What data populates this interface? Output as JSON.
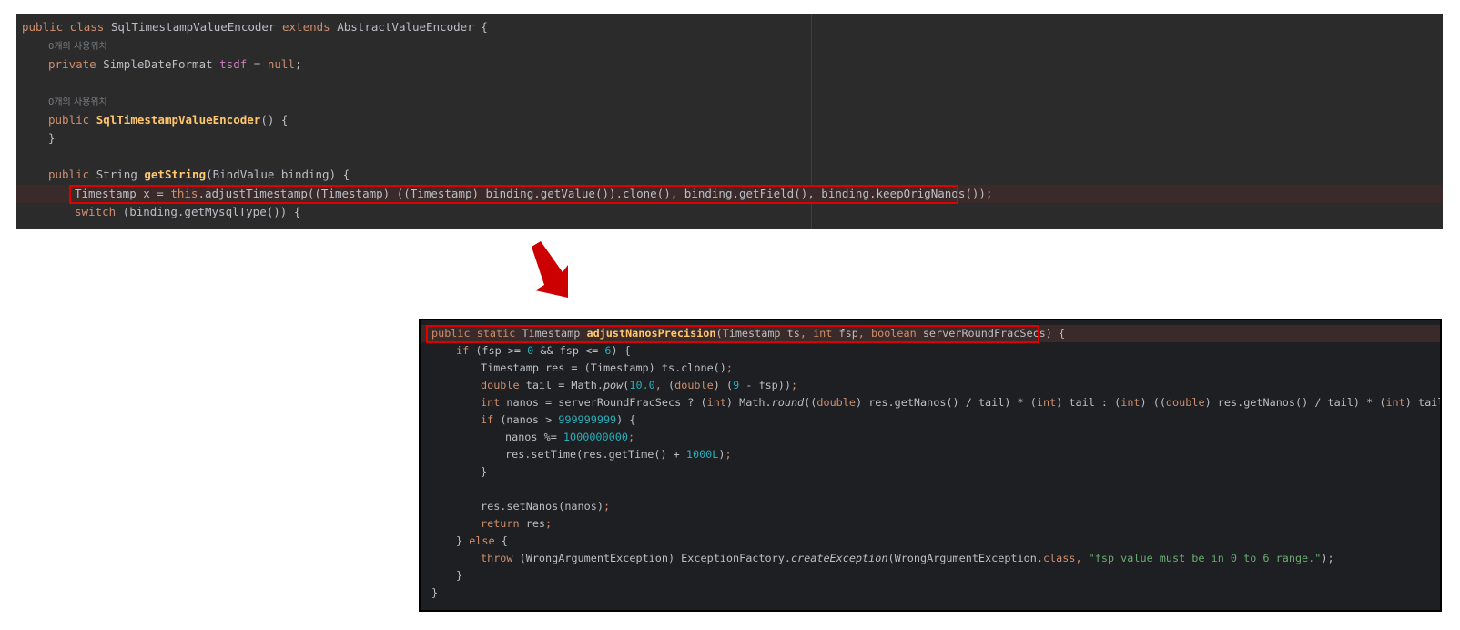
{
  "top": {
    "lines": [
      {
        "parts": [
          [
            "kw",
            "public class "
          ],
          [
            "cls",
            "SqlTimestampValueEncoder "
          ],
          [
            "kw",
            "extends "
          ],
          [
            "cls",
            "AbstractValueEncoder {"
          ]
        ]
      },
      {
        "hint": "0개의 사용위치"
      },
      {
        "parts": [
          [
            "kw",
            "private "
          ],
          [
            "cls",
            "SimpleDateFormat "
          ],
          [
            "fld",
            "tsdf"
          ],
          [
            "cls",
            " = "
          ],
          [
            "kw",
            "null"
          ],
          [
            "cls",
            ";"
          ]
        ]
      },
      {
        "parts": []
      },
      {
        "hint": "0개의 사용위치"
      },
      {
        "parts": [
          [
            "kw",
            "public "
          ],
          [
            "fn",
            "SqlTimestampValueEncoder"
          ],
          [
            "cls",
            "() {"
          ]
        ]
      },
      {
        "parts": [
          [
            "cls",
            "}"
          ]
        ]
      },
      {
        "parts": []
      },
      {
        "parts": [
          [
            "kw",
            "public "
          ],
          [
            "cls",
            "String "
          ],
          [
            "fn",
            "getString"
          ],
          [
            "cls",
            "(BindValue binding) {"
          ]
        ]
      },
      {
        "parts": [
          [
            "cls",
            "Timestamp x = "
          ],
          [
            "kw",
            "this"
          ],
          [
            "cls",
            ".adjustTimestamp((Timestamp) ((Timestamp) binding.getValue()).clone(), binding.getField(), binding.keepOrigNanos());"
          ]
        ]
      },
      {
        "parts": [
          [
            "kw",
            "switch "
          ],
          [
            "cls",
            "(binding.getMysqlType()) {"
          ]
        ]
      }
    ]
  },
  "bottom": {
    "lines": [
      {
        "parts": [
          [
            "kw",
            "public static "
          ],
          [
            "cls",
            "Timestamp "
          ],
          [
            "fn",
            "adjustNanosPrecision"
          ],
          [
            "cls",
            "(Timestamp ts"
          ],
          [
            "kw",
            ", int "
          ],
          [
            "cls",
            "fsp"
          ],
          [
            "kw",
            ", boolean "
          ],
          [
            "cls",
            "serverRoundFracSecs) {"
          ]
        ]
      },
      {
        "parts": [
          [
            "kw",
            "if "
          ],
          [
            "cls",
            "(fsp >= "
          ],
          [
            "numb",
            "0"
          ],
          [
            "cls",
            " && fsp <= "
          ],
          [
            "numb",
            "6"
          ],
          [
            "cls",
            ") {"
          ]
        ]
      },
      {
        "parts": [
          [
            "cls",
            "Timestamp res = (Timestamp) ts.clone()"
          ],
          [
            "kw",
            ";"
          ]
        ]
      },
      {
        "parts": [
          [
            "kw",
            "double "
          ],
          [
            "cls",
            "tail = Math."
          ],
          [
            "it",
            "pow"
          ],
          [
            "cls",
            "("
          ],
          [
            "numb",
            "10.0"
          ],
          [
            "kw",
            ", "
          ],
          [
            "cls",
            "("
          ],
          [
            "kw",
            "double"
          ],
          [
            "cls",
            ") ("
          ],
          [
            "numb",
            "9"
          ],
          [
            "cls",
            " - fsp))"
          ],
          [
            "kw",
            ";"
          ]
        ]
      },
      {
        "parts": [
          [
            "kw",
            "int "
          ],
          [
            "cls",
            "nanos = serverRoundFracSecs ? ("
          ],
          [
            "kw",
            "int"
          ],
          [
            "cls",
            ") Math."
          ],
          [
            "it",
            "round"
          ],
          [
            "cls",
            "(("
          ],
          [
            "kw",
            "double"
          ],
          [
            "cls",
            ") res.getNanos() / tail) * ("
          ],
          [
            "kw",
            "int"
          ],
          [
            "cls",
            ") tail : ("
          ],
          [
            "kw",
            "int"
          ],
          [
            "cls",
            ") (("
          ],
          [
            "kw",
            "double"
          ],
          [
            "cls",
            ") res.getNanos() / tail) * ("
          ],
          [
            "kw",
            "int"
          ],
          [
            "cls",
            ") tail"
          ],
          [
            "kw",
            ";"
          ]
        ]
      },
      {
        "parts": [
          [
            "kw",
            "if "
          ],
          [
            "cls",
            "(nanos > "
          ],
          [
            "numb",
            "999999999"
          ],
          [
            "cls",
            ") {"
          ]
        ]
      },
      {
        "parts": [
          [
            "cls",
            "nanos %= "
          ],
          [
            "numb",
            "1000000000"
          ],
          [
            "kw",
            ";"
          ]
        ]
      },
      {
        "parts": [
          [
            "cls",
            "res.setTime(res.getTime() + "
          ],
          [
            "numb",
            "1000L"
          ],
          [
            "cls",
            ")"
          ],
          [
            "kw",
            ";"
          ]
        ]
      },
      {
        "parts": [
          [
            "cls",
            "}"
          ]
        ]
      },
      {
        "parts": []
      },
      {
        "parts": [
          [
            "cls",
            "res.setNanos(nanos)"
          ],
          [
            "kw",
            ";"
          ]
        ]
      },
      {
        "parts": [
          [
            "kw",
            "return "
          ],
          [
            "cls",
            "res"
          ],
          [
            "kw",
            ";"
          ]
        ]
      },
      {
        "parts": [
          [
            "cls",
            "} "
          ],
          [
            "kw",
            "else "
          ],
          [
            "cls",
            "{"
          ]
        ]
      },
      {
        "parts": [
          [
            "kw",
            "throw "
          ],
          [
            "cls",
            "(WrongArgumentException) ExceptionFactory."
          ],
          [
            "it",
            "createException"
          ],
          [
            "cls",
            "(WrongArgumentException."
          ],
          [
            "kw",
            "class, "
          ],
          [
            "str",
            "\"fsp value must be in 0 to 6 range.\""
          ],
          [
            "cls",
            ");"
          ]
        ]
      },
      {
        "parts": [
          [
            "cls",
            "}"
          ]
        ]
      },
      {
        "parts": [
          [
            "cls",
            "}"
          ]
        ]
      }
    ]
  },
  "colors": {
    "keyword": "#cf8e6d",
    "function": "#ffc66d",
    "number": "#2aacb8",
    "string": "#6aab73",
    "highlight_box": "#e00000",
    "arrow": "#cc0000"
  },
  "icons": {
    "arrow": "arrow-down-right-icon"
  }
}
